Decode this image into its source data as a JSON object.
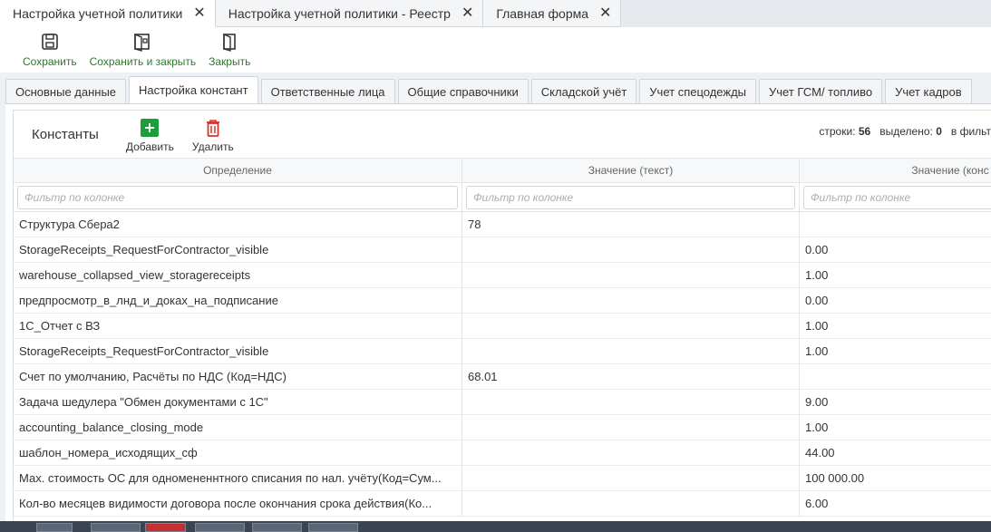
{
  "doc_tabs": [
    {
      "label": "Настройка учетной политики"
    },
    {
      "label": "Настройка учетной политики - Реестр"
    },
    {
      "label": "Главная форма"
    }
  ],
  "toolbar": {
    "save_label": "Сохранить",
    "save_close_label": "Сохранить и закрыть",
    "close_label": "Закрыть"
  },
  "section_tabs": [
    {
      "label": "Основные данные"
    },
    {
      "label": "Настройка констант"
    },
    {
      "label": "Ответственные лица"
    },
    {
      "label": "Общие справочники"
    },
    {
      "label": "Складской учёт"
    },
    {
      "label": "Учет спецодежды"
    },
    {
      "label": "Учет ГСМ/ топливо"
    },
    {
      "label": "Учет кадров"
    }
  ],
  "grid": {
    "title": "Константы",
    "add_label": "Добавить",
    "delete_label": "Удалить",
    "stats_rows_label": "строки:",
    "stats_rows_value": "56",
    "stats_selected_label": "выделено:",
    "stats_selected_value": "0",
    "stats_filter_label": "в фильт",
    "columns": [
      {
        "header": "Определение",
        "filter_placeholder": "Фильтр по колонке"
      },
      {
        "header": "Значение (текст)",
        "filter_placeholder": "Фильтр по колонке"
      },
      {
        "header": "Значение (конс",
        "filter_placeholder": "Фильтр по колонке"
      }
    ],
    "rows": [
      {
        "name": "Структура Сбера2",
        "text": "78",
        "num": ""
      },
      {
        "name": "StorageReceipts_RequestForContractor_visible",
        "text": "",
        "num": "0.00"
      },
      {
        "name": "warehouse_collapsed_view_storagereceipts",
        "text": "",
        "num": "1.00"
      },
      {
        "name": "предпросмотр_в_лнд_и_доках_на_подписание",
        "text": "",
        "num": "0.00"
      },
      {
        "name": "1С_Отчет с ВЗ",
        "text": "",
        "num": "1.00"
      },
      {
        "name": "StorageReceipts_RequestForContractor_visible",
        "text": "",
        "num": "1.00"
      },
      {
        "name": "Счет по умолчанию, Расчёты по НДС (Код=НДС)",
        "text": "68.01",
        "num": ""
      },
      {
        "name": "Задача шедулера \"Обмен документами с 1С\"",
        "text": "",
        "num": "9.00"
      },
      {
        "name": "accounting_balance_closing_mode",
        "text": "",
        "num": "1.00"
      },
      {
        "name": "шаблон_номера_исходящих_сф",
        "text": "",
        "num": "44.00"
      },
      {
        "name": "Мах. стоимость ОС для одномененнтного списания по нал. учёту(Код=Сум...",
        "text": "",
        "num": "100 000.00"
      },
      {
        "name": "Кол-во месяцев видимости договора после окончания срока действия(Ко...",
        "text": "",
        "num": "6.00"
      }
    ]
  },
  "colors": {
    "accent_green": "#2c7a2c",
    "add_icon": "#1e9e3a",
    "delete_icon": "#d9312b"
  }
}
